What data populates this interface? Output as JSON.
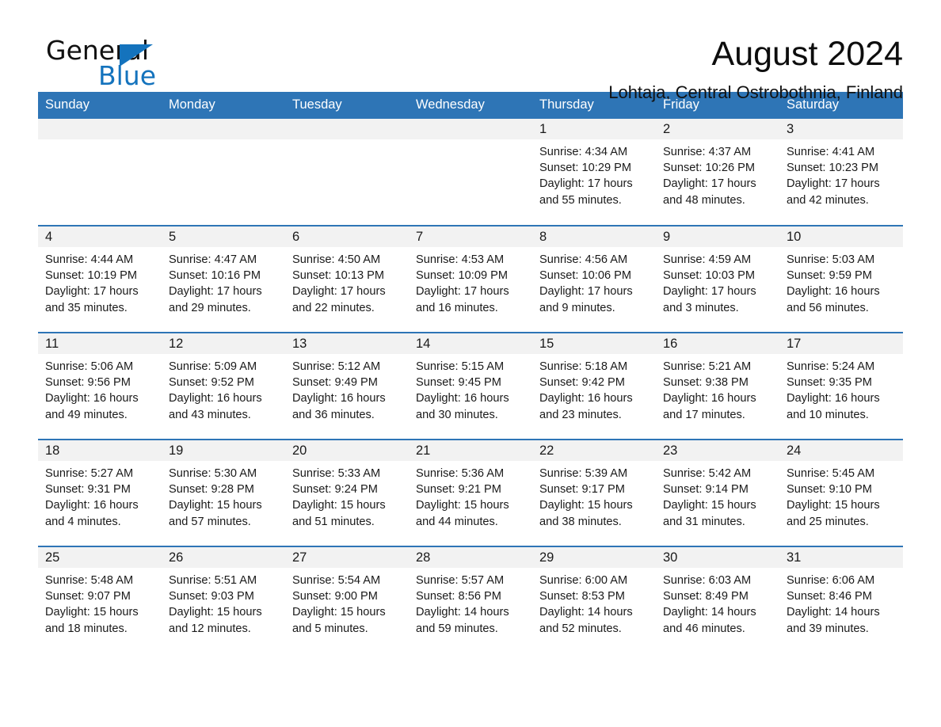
{
  "brand": {
    "name_part1": "General",
    "name_part2": "Blue",
    "accent_color": "#1473bd"
  },
  "header": {
    "month_title": "August 2024",
    "location": "Lohtaja, Central Ostrobothnia, Finland",
    "header_bg": "#2e75b6",
    "daynum_bg": "#f2f2f2"
  },
  "weekday_headers": [
    "Sunday",
    "Monday",
    "Tuesday",
    "Wednesday",
    "Thursday",
    "Friday",
    "Saturday"
  ],
  "labels": {
    "sunrise_prefix": "Sunrise:",
    "sunset_prefix": "Sunset:",
    "daylight_prefix": "Daylight:"
  },
  "weeks": [
    [
      {
        "day": "",
        "blank": true
      },
      {
        "day": "",
        "blank": true
      },
      {
        "day": "",
        "blank": true
      },
      {
        "day": "",
        "blank": true
      },
      {
        "day": "1",
        "sunrise": "Sunrise: 4:34 AM",
        "sunset": "Sunset: 10:29 PM",
        "daylight_line1": "Daylight: 17 hours",
        "daylight_line2": "and 55 minutes."
      },
      {
        "day": "2",
        "sunrise": "Sunrise: 4:37 AM",
        "sunset": "Sunset: 10:26 PM",
        "daylight_line1": "Daylight: 17 hours",
        "daylight_line2": "and 48 minutes."
      },
      {
        "day": "3",
        "sunrise": "Sunrise: 4:41 AM",
        "sunset": "Sunset: 10:23 PM",
        "daylight_line1": "Daylight: 17 hours",
        "daylight_line2": "and 42 minutes."
      }
    ],
    [
      {
        "day": "4",
        "sunrise": "Sunrise: 4:44 AM",
        "sunset": "Sunset: 10:19 PM",
        "daylight_line1": "Daylight: 17 hours",
        "daylight_line2": "and 35 minutes."
      },
      {
        "day": "5",
        "sunrise": "Sunrise: 4:47 AM",
        "sunset": "Sunset: 10:16 PM",
        "daylight_line1": "Daylight: 17 hours",
        "daylight_line2": "and 29 minutes."
      },
      {
        "day": "6",
        "sunrise": "Sunrise: 4:50 AM",
        "sunset": "Sunset: 10:13 PM",
        "daylight_line1": "Daylight: 17 hours",
        "daylight_line2": "and 22 minutes."
      },
      {
        "day": "7",
        "sunrise": "Sunrise: 4:53 AM",
        "sunset": "Sunset: 10:09 PM",
        "daylight_line1": "Daylight: 17 hours",
        "daylight_line2": "and 16 minutes."
      },
      {
        "day": "8",
        "sunrise": "Sunrise: 4:56 AM",
        "sunset": "Sunset: 10:06 PM",
        "daylight_line1": "Daylight: 17 hours",
        "daylight_line2": "and 9 minutes."
      },
      {
        "day": "9",
        "sunrise": "Sunrise: 4:59 AM",
        "sunset": "Sunset: 10:03 PM",
        "daylight_line1": "Daylight: 17 hours",
        "daylight_line2": "and 3 minutes."
      },
      {
        "day": "10",
        "sunrise": "Sunrise: 5:03 AM",
        "sunset": "Sunset: 9:59 PM",
        "daylight_line1": "Daylight: 16 hours",
        "daylight_line2": "and 56 minutes."
      }
    ],
    [
      {
        "day": "11",
        "sunrise": "Sunrise: 5:06 AM",
        "sunset": "Sunset: 9:56 PM",
        "daylight_line1": "Daylight: 16 hours",
        "daylight_line2": "and 49 minutes."
      },
      {
        "day": "12",
        "sunrise": "Sunrise: 5:09 AM",
        "sunset": "Sunset: 9:52 PM",
        "daylight_line1": "Daylight: 16 hours",
        "daylight_line2": "and 43 minutes."
      },
      {
        "day": "13",
        "sunrise": "Sunrise: 5:12 AM",
        "sunset": "Sunset: 9:49 PM",
        "daylight_line1": "Daylight: 16 hours",
        "daylight_line2": "and 36 minutes."
      },
      {
        "day": "14",
        "sunrise": "Sunrise: 5:15 AM",
        "sunset": "Sunset: 9:45 PM",
        "daylight_line1": "Daylight: 16 hours",
        "daylight_line2": "and 30 minutes."
      },
      {
        "day": "15",
        "sunrise": "Sunrise: 5:18 AM",
        "sunset": "Sunset: 9:42 PM",
        "daylight_line1": "Daylight: 16 hours",
        "daylight_line2": "and 23 minutes."
      },
      {
        "day": "16",
        "sunrise": "Sunrise: 5:21 AM",
        "sunset": "Sunset: 9:38 PM",
        "daylight_line1": "Daylight: 16 hours",
        "daylight_line2": "and 17 minutes."
      },
      {
        "day": "17",
        "sunrise": "Sunrise: 5:24 AM",
        "sunset": "Sunset: 9:35 PM",
        "daylight_line1": "Daylight: 16 hours",
        "daylight_line2": "and 10 minutes."
      }
    ],
    [
      {
        "day": "18",
        "sunrise": "Sunrise: 5:27 AM",
        "sunset": "Sunset: 9:31 PM",
        "daylight_line1": "Daylight: 16 hours",
        "daylight_line2": "and 4 minutes."
      },
      {
        "day": "19",
        "sunrise": "Sunrise: 5:30 AM",
        "sunset": "Sunset: 9:28 PM",
        "daylight_line1": "Daylight: 15 hours",
        "daylight_line2": "and 57 minutes."
      },
      {
        "day": "20",
        "sunrise": "Sunrise: 5:33 AM",
        "sunset": "Sunset: 9:24 PM",
        "daylight_line1": "Daylight: 15 hours",
        "daylight_line2": "and 51 minutes."
      },
      {
        "day": "21",
        "sunrise": "Sunrise: 5:36 AM",
        "sunset": "Sunset: 9:21 PM",
        "daylight_line1": "Daylight: 15 hours",
        "daylight_line2": "and 44 minutes."
      },
      {
        "day": "22",
        "sunrise": "Sunrise: 5:39 AM",
        "sunset": "Sunset: 9:17 PM",
        "daylight_line1": "Daylight: 15 hours",
        "daylight_line2": "and 38 minutes."
      },
      {
        "day": "23",
        "sunrise": "Sunrise: 5:42 AM",
        "sunset": "Sunset: 9:14 PM",
        "daylight_line1": "Daylight: 15 hours",
        "daylight_line2": "and 31 minutes."
      },
      {
        "day": "24",
        "sunrise": "Sunrise: 5:45 AM",
        "sunset": "Sunset: 9:10 PM",
        "daylight_line1": "Daylight: 15 hours",
        "daylight_line2": "and 25 minutes."
      }
    ],
    [
      {
        "day": "25",
        "sunrise": "Sunrise: 5:48 AM",
        "sunset": "Sunset: 9:07 PM",
        "daylight_line1": "Daylight: 15 hours",
        "daylight_line2": "and 18 minutes."
      },
      {
        "day": "26",
        "sunrise": "Sunrise: 5:51 AM",
        "sunset": "Sunset: 9:03 PM",
        "daylight_line1": "Daylight: 15 hours",
        "daylight_line2": "and 12 minutes."
      },
      {
        "day": "27",
        "sunrise": "Sunrise: 5:54 AM",
        "sunset": "Sunset: 9:00 PM",
        "daylight_line1": "Daylight: 15 hours",
        "daylight_line2": "and 5 minutes."
      },
      {
        "day": "28",
        "sunrise": "Sunrise: 5:57 AM",
        "sunset": "Sunset: 8:56 PM",
        "daylight_line1": "Daylight: 14 hours",
        "daylight_line2": "and 59 minutes."
      },
      {
        "day": "29",
        "sunrise": "Sunrise: 6:00 AM",
        "sunset": "Sunset: 8:53 PM",
        "daylight_line1": "Daylight: 14 hours",
        "daylight_line2": "and 52 minutes."
      },
      {
        "day": "30",
        "sunrise": "Sunrise: 6:03 AM",
        "sunset": "Sunset: 8:49 PM",
        "daylight_line1": "Daylight: 14 hours",
        "daylight_line2": "and 46 minutes."
      },
      {
        "day": "31",
        "sunrise": "Sunrise: 6:06 AM",
        "sunset": "Sunset: 8:46 PM",
        "daylight_line1": "Daylight: 14 hours",
        "daylight_line2": "and 39 minutes."
      }
    ]
  ]
}
